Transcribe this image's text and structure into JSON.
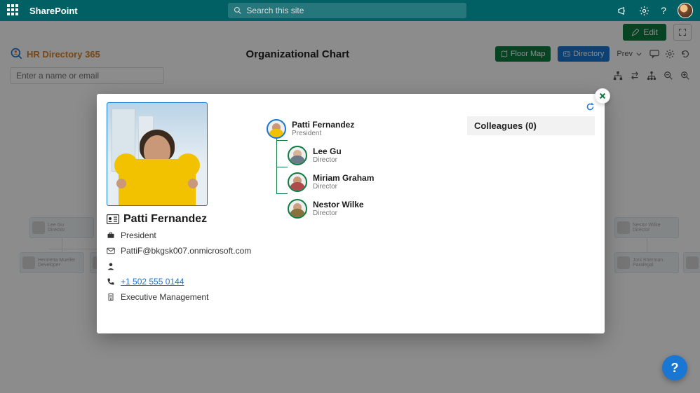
{
  "suite": {
    "brand": "SharePoint",
    "search_placeholder": "Search this site"
  },
  "command_bar": {
    "edit_label": "Edit"
  },
  "app": {
    "name": "HR Directory 365",
    "page_title": "Organizational Chart",
    "floor_map_label": "Floor Map",
    "directory_label": "Directory",
    "prev_label": "Prev",
    "name_input_placeholder": "Enter a name or email"
  },
  "profile": {
    "name": "Patti Fernandez",
    "title": "President",
    "email": "PattiF@bkgsk007.onmicrosoft.com",
    "phone": "+1 502 555 0144",
    "department": "Executive Management"
  },
  "hierarchy": {
    "root": {
      "name": "Patti Fernandez",
      "role": "President",
      "shirt": "#f2c200",
      "skin": "#c89878"
    },
    "reports": [
      {
        "name": "Lee Gu",
        "role": "Director",
        "shirt": "#6a7a88",
        "skin": "#d9b395"
      },
      {
        "name": "Miriam Graham",
        "role": "Director",
        "shirt": "#b04a4a",
        "skin": "#c89878"
      },
      {
        "name": "Nestor Wilke",
        "role": "Director",
        "shirt": "#88703f",
        "skin": "#caa07e"
      }
    ]
  },
  "colleagues": {
    "header": "Colleagues (0)"
  },
  "help_fab": "?"
}
